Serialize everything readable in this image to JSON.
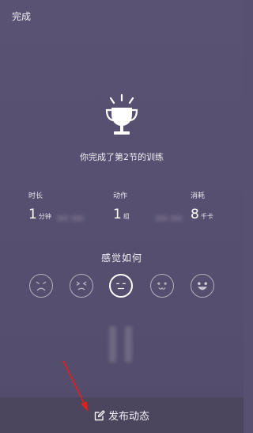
{
  "header": {
    "done_label": "完成"
  },
  "result": {
    "completed_text": "你完成了第2节的训练"
  },
  "stats": {
    "time": {
      "label": "时长",
      "value": "1",
      "unit": "分钟"
    },
    "moves": {
      "label": "动作",
      "value": "1",
      "unit": "组"
    },
    "burn": {
      "label": "消耗",
      "value": "8",
      "unit": "千卡"
    }
  },
  "feeling": {
    "title": "感觉如何",
    "faces": [
      "very-hard-face-icon",
      "hard-face-icon",
      "neutral-face-icon",
      "good-face-icon",
      "easy-face-icon"
    ],
    "selected_index": 2
  },
  "footer": {
    "publish_label": "发布动态"
  },
  "colors": {
    "background": "#585070",
    "bottom_bar": "#4b455e",
    "annotation_arrow": "#e02020"
  }
}
